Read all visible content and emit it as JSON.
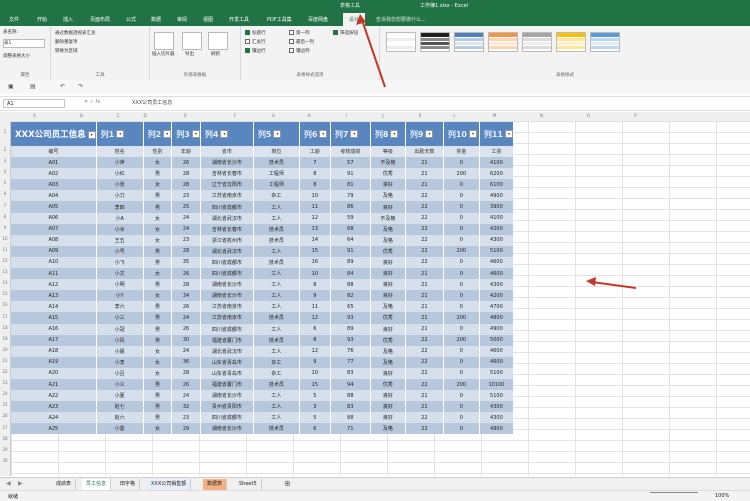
{
  "window": {
    "title": "工作簿1.xlsx - Excel",
    "context_tab": "表格工具"
  },
  "tabs": [
    "文件",
    "开始",
    "插入",
    "页面布局",
    "公式",
    "数据",
    "审阅",
    "视图",
    "开发工具",
    "PDF工具集",
    "百度网盘",
    "设计"
  ],
  "tell_me": "告诉我您想要做什么...",
  "ribbon": {
    "properties": {
      "table_name_label": "表名称:",
      "table_name": "表1",
      "resize": "调整表格大小",
      "group": "属性"
    },
    "tools": {
      "items": [
        "通过数据透视表汇总",
        "删除重复项",
        "转换为区域"
      ],
      "group": "工具"
    },
    "external": {
      "items": [
        "插入切片器",
        "导出",
        "刷新"
      ],
      "group": "外部表数据"
    },
    "options": {
      "items": [
        "标题行",
        "汇总行",
        "镶边行",
        "第一列",
        "最后一列",
        "镶边列",
        "筛选按钮"
      ],
      "group": "表格样式选项"
    },
    "styles": {
      "group": "表格样式"
    }
  },
  "formula_bar": {
    "name_box": "A1",
    "value": "XXX公司员工信息"
  },
  "columns": [
    "A",
    "B",
    "C",
    "D",
    "E",
    "F",
    "G",
    "H",
    "I",
    "J",
    "K",
    "L",
    "M",
    "N",
    "O",
    "P"
  ],
  "table": {
    "title": "XXX公司员工信息",
    "top_headers": [
      "列1",
      "列2",
      "列3",
      "列4",
      "列5",
      "列6",
      "列7",
      "列8",
      "列9",
      "列10",
      "列11"
    ],
    "headers": [
      "编号",
      "姓名",
      "性别",
      "年龄",
      "省市",
      "岗位",
      "工龄",
      "考核成绩",
      "等级",
      "出勤天数",
      "奖金",
      "工资"
    ],
    "rows": [
      [
        "A01",
        "小萍",
        "女",
        "26",
        "湖南省长沙市",
        "技术员",
        "7",
        "57",
        "不及格",
        "21",
        "0",
        "4100"
      ],
      [
        "A02",
        "小红",
        "男",
        "28",
        "吉林省长春市",
        "工程师",
        "8",
        "91",
        "优秀",
        "21",
        "200",
        "6200"
      ],
      [
        "A03",
        "小张",
        "女",
        "28",
        "辽宁省沈阳市",
        "工程师",
        "8",
        "81",
        "良好",
        "21",
        "0",
        "6100"
      ],
      [
        "A04",
        "小刀",
        "男",
        "23",
        "江苏省南京市",
        "杂工",
        "10",
        "79",
        "及格",
        "22",
        "0",
        "4900"
      ],
      [
        "A05",
        "李四",
        "男",
        "25",
        "四川省成都市",
        "工人",
        "11",
        "86",
        "良好",
        "22",
        "0",
        "3900"
      ],
      [
        "A06",
        "小A",
        "女",
        "24",
        "湖北省武汉市",
        "工人",
        "12",
        "59",
        "不及格",
        "22",
        "0",
        "4100"
      ],
      [
        "A07",
        "小冰",
        "女",
        "24",
        "吉林省长春市",
        "技术员",
        "13",
        "68",
        "及格",
        "22",
        "0",
        "4200"
      ],
      [
        "A08",
        "王五",
        "女",
        "23",
        "浙江省杭州市",
        "技术员",
        "14",
        "64",
        "及格",
        "22",
        "0",
        "4300"
      ],
      [
        "A09",
        "小号",
        "男",
        "28",
        "湖北省武汉市",
        "工人",
        "15",
        "91",
        "优秀",
        "22",
        "200",
        "5100"
      ],
      [
        "A10",
        "小飞",
        "男",
        "35",
        "四川省成都市",
        "技术员",
        "16",
        "89",
        "良好",
        "22",
        "0",
        "4600"
      ],
      [
        "A11",
        "小文",
        "女",
        "26",
        "四川省成都市",
        "工人",
        "10",
        "84",
        "良好",
        "21",
        "0",
        "4600"
      ],
      [
        "A12",
        "小明",
        "男",
        "28",
        "湖南省长沙市",
        "工人",
        "8",
        "88",
        "良好",
        "21",
        "0",
        "4300"
      ],
      [
        "A13",
        "小Y",
        "女",
        "34",
        "湖南省长沙市",
        "工人",
        "9",
        "82",
        "良好",
        "21",
        "0",
        "4200"
      ],
      [
        "A14",
        "李六",
        "男",
        "26",
        "江苏省南京市",
        "工人",
        "11",
        "65",
        "及格",
        "21",
        "0",
        "4700"
      ],
      [
        "A15",
        "小三",
        "男",
        "24",
        "江苏省南京市",
        "技术员",
        "12",
        "93",
        "优秀",
        "21",
        "200",
        "4800"
      ],
      [
        "A16",
        "小冠",
        "男",
        "26",
        "四川省成都市",
        "工人",
        "6",
        "89",
        "良好",
        "21",
        "0",
        "4900"
      ],
      [
        "A17",
        "小风",
        "男",
        "30",
        "福建省厦门市",
        "技术员",
        "8",
        "93",
        "优秀",
        "22",
        "200",
        "5000"
      ],
      [
        "A18",
        "小晨",
        "女",
        "24",
        "湖北省武汉市",
        "工人",
        "12",
        "76",
        "及格",
        "22",
        "0",
        "4600"
      ],
      [
        "A19",
        "小李",
        "女",
        "36",
        "山东省青岛市",
        "杂工",
        "9",
        "77",
        "及格",
        "22",
        "0",
        "4600"
      ],
      [
        "A20",
        "小吕",
        "女",
        "28",
        "山东省青岛市",
        "杂工",
        "10",
        "83",
        "良好",
        "22",
        "0",
        "5100"
      ],
      [
        "A21",
        "小义",
        "男",
        "26",
        "福建省厦门市",
        "技术员",
        "15",
        "94",
        "优秀",
        "22",
        "200",
        "10100"
      ],
      [
        "A22",
        "小夏",
        "男",
        "24",
        "湖南省长沙市",
        "工人",
        "5",
        "88",
        "良好",
        "21",
        "0",
        "5100"
      ],
      [
        "A23",
        "赵七",
        "男",
        "32",
        "贵州省贵阳市",
        "工人",
        "3",
        "83",
        "良好",
        "21",
        "0",
        "4300"
      ],
      [
        "A24",
        "赵六",
        "男",
        "23",
        "四川省成都市",
        "工人",
        "5",
        "88",
        "良好",
        "22",
        "0",
        "4300"
      ],
      [
        "A25",
        "小曼",
        "女",
        "29",
        "湖南省长沙市",
        "技术员",
        "6",
        "71",
        "及格",
        "22",
        "0",
        "4800"
      ]
    ]
  },
  "sheets": [
    "成绩表",
    "员工信息",
    "田字格",
    "XXX公司销售额",
    "数据表",
    "Sheet5"
  ],
  "status": {
    "ready": "就绪",
    "zoom": "100%"
  },
  "colors": {
    "ribbon_green": "#217346",
    "table_header": "#5a86bf",
    "band_dark": "#b8c8dc",
    "band_light": "#d6e0ec",
    "annotation_red": "#c0392b"
  }
}
